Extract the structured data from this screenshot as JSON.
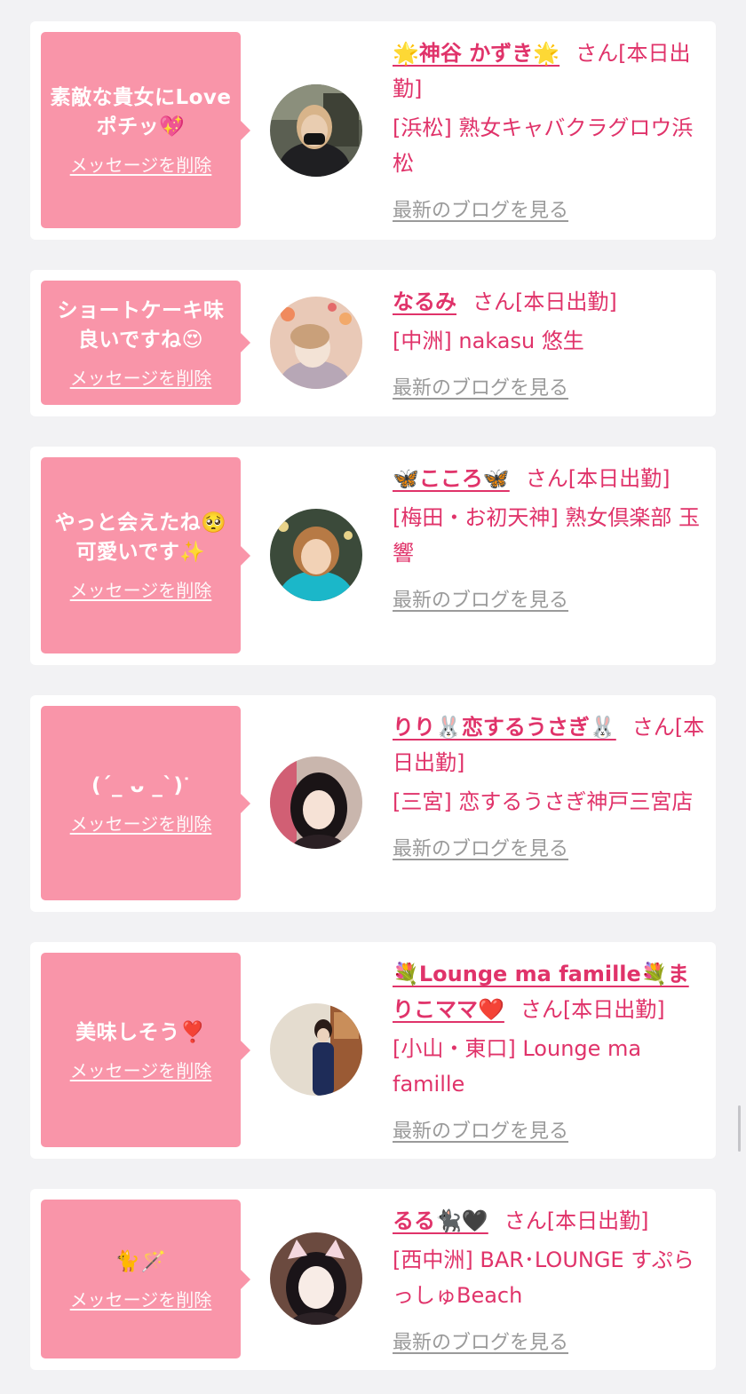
{
  "delete_label": "メッセージを削除",
  "blog_label": "最新のブログを見る",
  "san_suffix": "さん[本日出勤]",
  "colors": {
    "accent": "#e0336a",
    "bubble": "#f995a9",
    "link_gray": "#9a9a9a",
    "background": "#f2f2f4"
  },
  "messages": [
    {
      "message": "素敵な貴女にLove ポチッ💖",
      "name": "🌟神谷 かずき🌟",
      "shop": "[浜松] 熟女キャバクラグロウ浜松"
    },
    {
      "message": "ショートケーキ味 良いですね😍",
      "name": "なるみ",
      "shop": "[中洲] nakasu 悠生"
    },
    {
      "message": "やっと会えたね🥺 可愛いです✨",
      "name": "🦋こころ🦋",
      "shop": "[梅田・お初天神] 熟女倶楽部 玉響"
    },
    {
      "message": "(ˊ_ ᴗ _ˋ)ᐝ",
      "name": "りり🐰恋するうさぎ🐰",
      "shop": "[三宮] 恋するうさぎ神戸三宮店"
    },
    {
      "message": "美味しそう❣️",
      "name": "💐Lounge ma famille💐まりこママ❤️",
      "shop": "[小山・東口] Lounge ma famille"
    },
    {
      "message": "🐈🪄",
      "name": "るる🐈‍⬛🖤",
      "shop": "[西中洲] BAR･LOUNGE すぷらっしゅBeach"
    }
  ]
}
